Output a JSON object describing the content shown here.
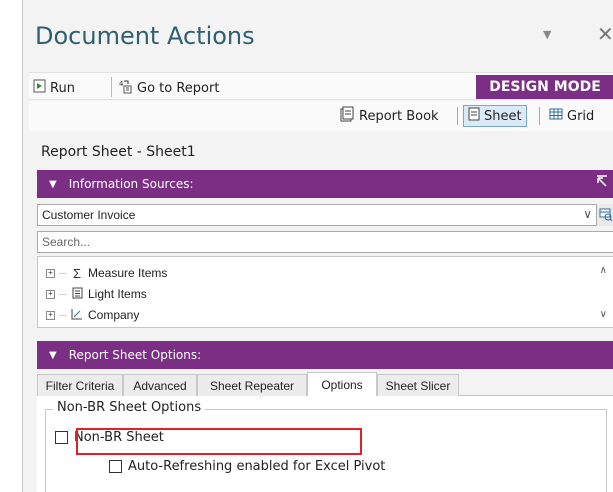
{
  "window": {
    "title": "Document Actions",
    "dropdown_icon": "chevron-down-icon",
    "close_icon": "close-icon"
  },
  "toolbar": {
    "run_label": "Run",
    "go_to_report_label": "Go to Report",
    "mode_badge": "DESIGN MODE",
    "mode_badge_color": "#7b2f84"
  },
  "view_bar": {
    "report_book_label": "Report Book",
    "sheet_label": "Sheet",
    "grid_label": "Grid",
    "active": "Sheet"
  },
  "sheet_title": "Report Sheet - Sheet1",
  "information_sources": {
    "header": "Information Sources:",
    "selected_source": "Customer Invoice",
    "search_placeholder": "Search...",
    "tree": [
      {
        "label": "Measure Items",
        "icon": "sigma-icon"
      },
      {
        "label": "Light Items",
        "icon": "document-icon"
      },
      {
        "label": "Company",
        "icon": "hierarchy-icon"
      }
    ]
  },
  "report_sheet_options": {
    "header": "Report Sheet Options:",
    "tabs": [
      "Filter Criteria",
      "Advanced",
      "Sheet Repeater",
      "Options",
      "Sheet Slicer"
    ],
    "active_tab": "Options",
    "group_label": "Non-BR Sheet Options",
    "non_br_sheet_label": "Non-BR Sheet",
    "non_br_sheet_checked": false,
    "auto_refresh_label": "Auto-Refreshing enabled for Excel Pivot",
    "auto_refresh_checked": false
  }
}
